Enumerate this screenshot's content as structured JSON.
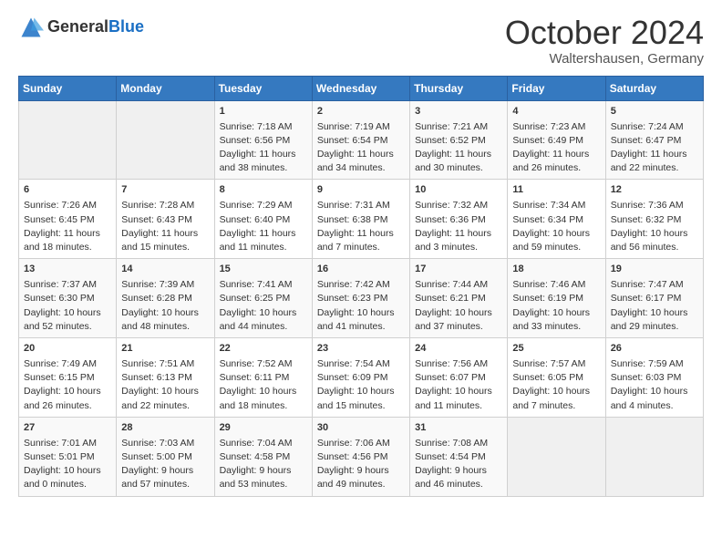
{
  "header": {
    "logo_general": "General",
    "logo_blue": "Blue",
    "title": "October 2024",
    "subtitle": "Waltershausen, Germany"
  },
  "days_of_week": [
    "Sunday",
    "Monday",
    "Tuesday",
    "Wednesday",
    "Thursday",
    "Friday",
    "Saturday"
  ],
  "weeks": [
    [
      {
        "day": "",
        "lines": []
      },
      {
        "day": "",
        "lines": []
      },
      {
        "day": "1",
        "lines": [
          "Sunrise: 7:18 AM",
          "Sunset: 6:56 PM",
          "Daylight: 11 hours",
          "and 38 minutes."
        ]
      },
      {
        "day": "2",
        "lines": [
          "Sunrise: 7:19 AM",
          "Sunset: 6:54 PM",
          "Daylight: 11 hours",
          "and 34 minutes."
        ]
      },
      {
        "day": "3",
        "lines": [
          "Sunrise: 7:21 AM",
          "Sunset: 6:52 PM",
          "Daylight: 11 hours",
          "and 30 minutes."
        ]
      },
      {
        "day": "4",
        "lines": [
          "Sunrise: 7:23 AM",
          "Sunset: 6:49 PM",
          "Daylight: 11 hours",
          "and 26 minutes."
        ]
      },
      {
        "day": "5",
        "lines": [
          "Sunrise: 7:24 AM",
          "Sunset: 6:47 PM",
          "Daylight: 11 hours",
          "and 22 minutes."
        ]
      }
    ],
    [
      {
        "day": "6",
        "lines": [
          "Sunrise: 7:26 AM",
          "Sunset: 6:45 PM",
          "Daylight: 11 hours",
          "and 18 minutes."
        ]
      },
      {
        "day": "7",
        "lines": [
          "Sunrise: 7:28 AM",
          "Sunset: 6:43 PM",
          "Daylight: 11 hours",
          "and 15 minutes."
        ]
      },
      {
        "day": "8",
        "lines": [
          "Sunrise: 7:29 AM",
          "Sunset: 6:40 PM",
          "Daylight: 11 hours",
          "and 11 minutes."
        ]
      },
      {
        "day": "9",
        "lines": [
          "Sunrise: 7:31 AM",
          "Sunset: 6:38 PM",
          "Daylight: 11 hours",
          "and 7 minutes."
        ]
      },
      {
        "day": "10",
        "lines": [
          "Sunrise: 7:32 AM",
          "Sunset: 6:36 PM",
          "Daylight: 11 hours",
          "and 3 minutes."
        ]
      },
      {
        "day": "11",
        "lines": [
          "Sunrise: 7:34 AM",
          "Sunset: 6:34 PM",
          "Daylight: 10 hours",
          "and 59 minutes."
        ]
      },
      {
        "day": "12",
        "lines": [
          "Sunrise: 7:36 AM",
          "Sunset: 6:32 PM",
          "Daylight: 10 hours",
          "and 56 minutes."
        ]
      }
    ],
    [
      {
        "day": "13",
        "lines": [
          "Sunrise: 7:37 AM",
          "Sunset: 6:30 PM",
          "Daylight: 10 hours",
          "and 52 minutes."
        ]
      },
      {
        "day": "14",
        "lines": [
          "Sunrise: 7:39 AM",
          "Sunset: 6:28 PM",
          "Daylight: 10 hours",
          "and 48 minutes."
        ]
      },
      {
        "day": "15",
        "lines": [
          "Sunrise: 7:41 AM",
          "Sunset: 6:25 PM",
          "Daylight: 10 hours",
          "and 44 minutes."
        ]
      },
      {
        "day": "16",
        "lines": [
          "Sunrise: 7:42 AM",
          "Sunset: 6:23 PM",
          "Daylight: 10 hours",
          "and 41 minutes."
        ]
      },
      {
        "day": "17",
        "lines": [
          "Sunrise: 7:44 AM",
          "Sunset: 6:21 PM",
          "Daylight: 10 hours",
          "and 37 minutes."
        ]
      },
      {
        "day": "18",
        "lines": [
          "Sunrise: 7:46 AM",
          "Sunset: 6:19 PM",
          "Daylight: 10 hours",
          "and 33 minutes."
        ]
      },
      {
        "day": "19",
        "lines": [
          "Sunrise: 7:47 AM",
          "Sunset: 6:17 PM",
          "Daylight: 10 hours",
          "and 29 minutes."
        ]
      }
    ],
    [
      {
        "day": "20",
        "lines": [
          "Sunrise: 7:49 AM",
          "Sunset: 6:15 PM",
          "Daylight: 10 hours",
          "and 26 minutes."
        ]
      },
      {
        "day": "21",
        "lines": [
          "Sunrise: 7:51 AM",
          "Sunset: 6:13 PM",
          "Daylight: 10 hours",
          "and 22 minutes."
        ]
      },
      {
        "day": "22",
        "lines": [
          "Sunrise: 7:52 AM",
          "Sunset: 6:11 PM",
          "Daylight: 10 hours",
          "and 18 minutes."
        ]
      },
      {
        "day": "23",
        "lines": [
          "Sunrise: 7:54 AM",
          "Sunset: 6:09 PM",
          "Daylight: 10 hours",
          "and 15 minutes."
        ]
      },
      {
        "day": "24",
        "lines": [
          "Sunrise: 7:56 AM",
          "Sunset: 6:07 PM",
          "Daylight: 10 hours",
          "and 11 minutes."
        ]
      },
      {
        "day": "25",
        "lines": [
          "Sunrise: 7:57 AM",
          "Sunset: 6:05 PM",
          "Daylight: 10 hours",
          "and 7 minutes."
        ]
      },
      {
        "day": "26",
        "lines": [
          "Sunrise: 7:59 AM",
          "Sunset: 6:03 PM",
          "Daylight: 10 hours",
          "and 4 minutes."
        ]
      }
    ],
    [
      {
        "day": "27",
        "lines": [
          "Sunrise: 7:01 AM",
          "Sunset: 5:01 PM",
          "Daylight: 10 hours",
          "and 0 minutes."
        ]
      },
      {
        "day": "28",
        "lines": [
          "Sunrise: 7:03 AM",
          "Sunset: 5:00 PM",
          "Daylight: 9 hours",
          "and 57 minutes."
        ]
      },
      {
        "day": "29",
        "lines": [
          "Sunrise: 7:04 AM",
          "Sunset: 4:58 PM",
          "Daylight: 9 hours",
          "and 53 minutes."
        ]
      },
      {
        "day": "30",
        "lines": [
          "Sunrise: 7:06 AM",
          "Sunset: 4:56 PM",
          "Daylight: 9 hours",
          "and 49 minutes."
        ]
      },
      {
        "day": "31",
        "lines": [
          "Sunrise: 7:08 AM",
          "Sunset: 4:54 PM",
          "Daylight: 9 hours",
          "and 46 minutes."
        ]
      },
      {
        "day": "",
        "lines": []
      },
      {
        "day": "",
        "lines": []
      }
    ]
  ]
}
